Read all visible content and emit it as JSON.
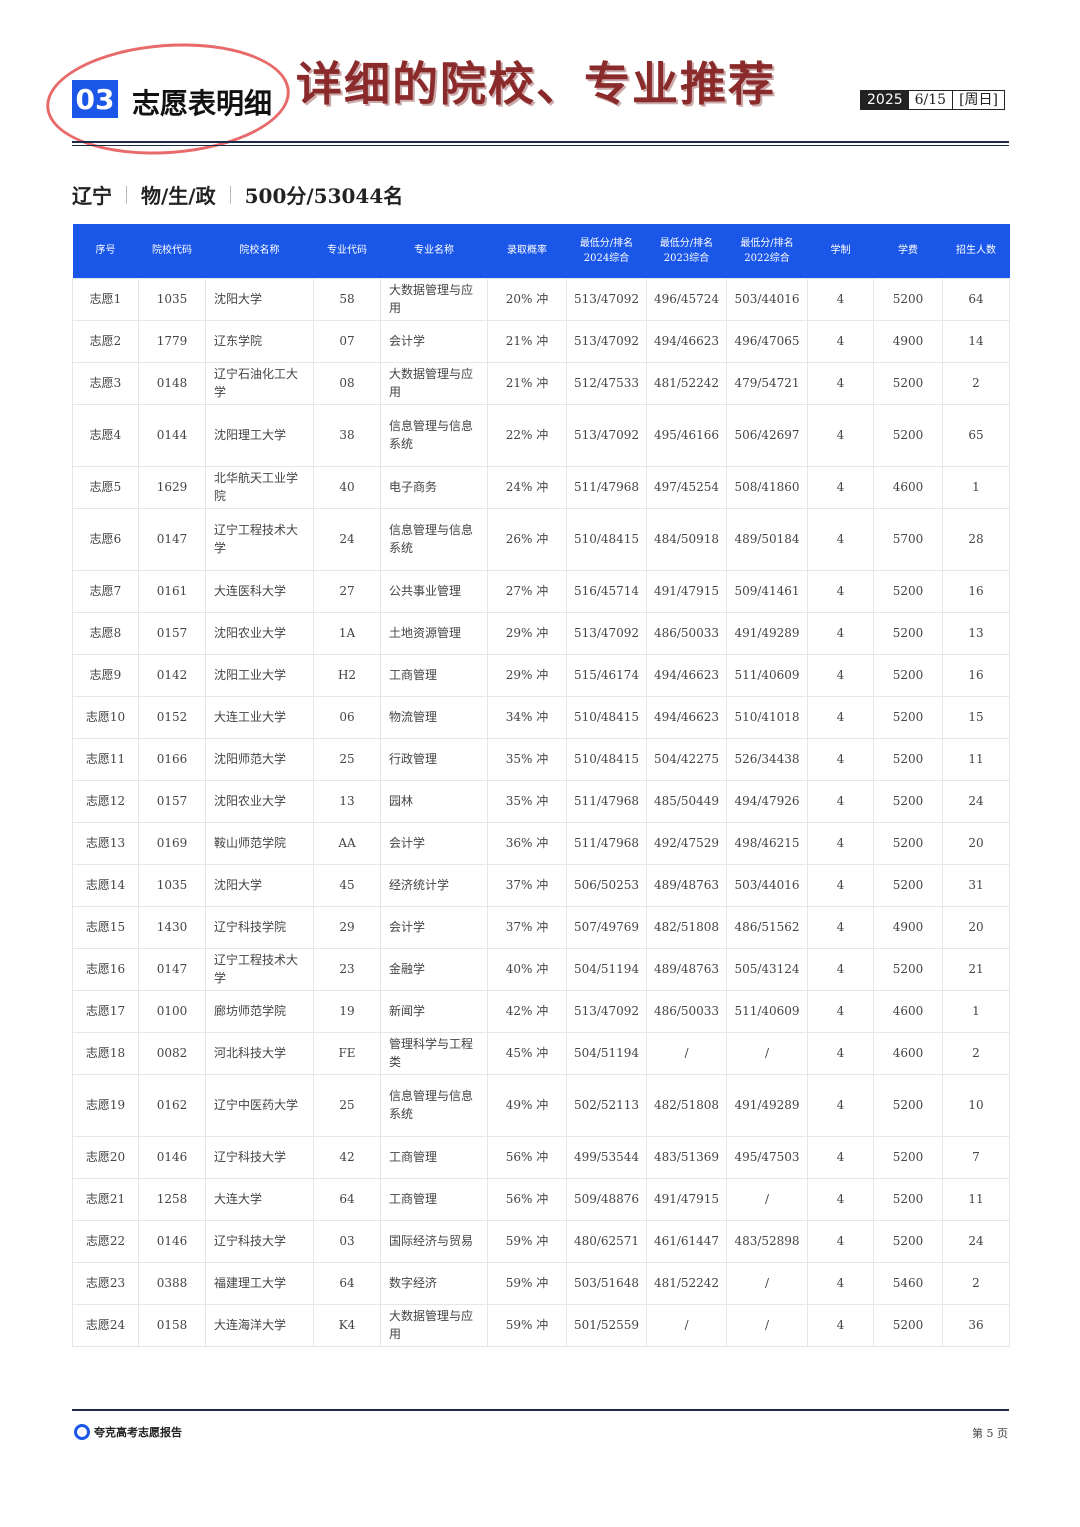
{
  "header": {
    "section_number": "03",
    "section_title": "志愿表明细",
    "annotation": "详细的院校、专业推荐",
    "date_year": "2025",
    "date_md": "6/15",
    "date_weekday": "[周日]"
  },
  "subheader": {
    "province": "辽宁",
    "subjects": "物/生/政",
    "score_rank": "500分/53044名"
  },
  "table": {
    "columns": [
      "序号",
      "院校代码",
      "院校名称",
      "专业代码",
      "专业名称",
      "录取概率",
      "最低分/排名\n2024综合",
      "最低分/排名\n2023综合",
      "最低分/排名\n2022综合",
      "学制",
      "学费",
      "招生人数"
    ],
    "rows": [
      [
        "志愿1",
        "1035",
        "沈阳大学",
        "58",
        "大数据管理与应用",
        "20% 冲",
        "513/47092",
        "496/45724",
        "503/44016",
        "4",
        "5200",
        "64"
      ],
      [
        "志愿2",
        "1779",
        "辽东学院",
        "07",
        "会计学",
        "21% 冲",
        "513/47092",
        "494/46623",
        "496/47065",
        "4",
        "4900",
        "14"
      ],
      [
        "志愿3",
        "0148",
        "辽宁石油化工大学",
        "08",
        "大数据管理与应用",
        "21% 冲",
        "512/47533",
        "481/52242",
        "479/54721",
        "4",
        "5200",
        "2"
      ],
      [
        "志愿4",
        "0144",
        "沈阳理工大学",
        "38",
        "信息管理与信息系统",
        "22% 冲",
        "513/47092",
        "495/46166",
        "506/42697",
        "4",
        "5200",
        "65"
      ],
      [
        "志愿5",
        "1629",
        "北华航天工业学院",
        "40",
        "电子商务",
        "24% 冲",
        "511/47968",
        "497/45254",
        "508/41860",
        "4",
        "4600",
        "1"
      ],
      [
        "志愿6",
        "0147",
        "辽宁工程技术大学",
        "24",
        "信息管理与信息系统",
        "26% 冲",
        "510/48415",
        "484/50918",
        "489/50184",
        "4",
        "5700",
        "28"
      ],
      [
        "志愿7",
        "0161",
        "大连医科大学",
        "27",
        "公共事业管理",
        "27% 冲",
        "516/45714",
        "491/47915",
        "509/41461",
        "4",
        "5200",
        "16"
      ],
      [
        "志愿8",
        "0157",
        "沈阳农业大学",
        "1A",
        "土地资源管理",
        "29% 冲",
        "513/47092",
        "486/50033",
        "491/49289",
        "4",
        "5200",
        "13"
      ],
      [
        "志愿9",
        "0142",
        "沈阳工业大学",
        "H2",
        "工商管理",
        "29% 冲",
        "515/46174",
        "494/46623",
        "511/40609",
        "4",
        "5200",
        "16"
      ],
      [
        "志愿10",
        "0152",
        "大连工业大学",
        "06",
        "物流管理",
        "34% 冲",
        "510/48415",
        "494/46623",
        "510/41018",
        "4",
        "5200",
        "15"
      ],
      [
        "志愿11",
        "0166",
        "沈阳师范大学",
        "25",
        "行政管理",
        "35% 冲",
        "510/48415",
        "504/42275",
        "526/34438",
        "4",
        "5200",
        "11"
      ],
      [
        "志愿12",
        "0157",
        "沈阳农业大学",
        "13",
        "园林",
        "35% 冲",
        "511/47968",
        "485/50449",
        "494/47926",
        "4",
        "5200",
        "24"
      ],
      [
        "志愿13",
        "0169",
        "鞍山师范学院",
        "AA",
        "会计学",
        "36% 冲",
        "511/47968",
        "492/47529",
        "498/46215",
        "4",
        "5200",
        "20"
      ],
      [
        "志愿14",
        "1035",
        "沈阳大学",
        "45",
        "经济统计学",
        "37% 冲",
        "506/50253",
        "489/48763",
        "503/44016",
        "4",
        "5200",
        "31"
      ],
      [
        "志愿15",
        "1430",
        "辽宁科技学院",
        "29",
        "会计学",
        "37% 冲",
        "507/49769",
        "482/51808",
        "486/51562",
        "4",
        "4900",
        "20"
      ],
      [
        "志愿16",
        "0147",
        "辽宁工程技术大学",
        "23",
        "金融学",
        "40% 冲",
        "504/51194",
        "489/48763",
        "505/43124",
        "4",
        "5200",
        "21"
      ],
      [
        "志愿17",
        "0100",
        "廊坊师范学院",
        "19",
        "新闻学",
        "42% 冲",
        "513/47092",
        "486/50033",
        "511/40609",
        "4",
        "4600",
        "1"
      ],
      [
        "志愿18",
        "0082",
        "河北科技大学",
        "FE",
        "管理科学与工程类",
        "45% 冲",
        "504/51194",
        "/",
        "/",
        "4",
        "4600",
        "2"
      ],
      [
        "志愿19",
        "0162",
        "辽宁中医药大学",
        "25",
        "信息管理与信息系统",
        "49% 冲",
        "502/52113",
        "482/51808",
        "491/49289",
        "4",
        "5200",
        "10"
      ],
      [
        "志愿20",
        "0146",
        "辽宁科技大学",
        "42",
        "工商管理",
        "56% 冲",
        "499/53544",
        "483/51369",
        "495/47503",
        "4",
        "5200",
        "7"
      ],
      [
        "志愿21",
        "1258",
        "大连大学",
        "64",
        "工商管理",
        "56% 冲",
        "509/48876",
        "491/47915",
        "/",
        "4",
        "5200",
        "11"
      ],
      [
        "志愿22",
        "0146",
        "辽宁科技大学",
        "03",
        "国际经济与贸易",
        "59% 冲",
        "480/62571",
        "461/61447",
        "483/52898",
        "4",
        "5200",
        "24"
      ],
      [
        "志愿23",
        "0388",
        "福建理工大学",
        "64",
        "数字经济",
        "59% 冲",
        "503/51648",
        "481/52242",
        "/",
        "4",
        "5460",
        "2"
      ],
      [
        "志愿24",
        "0158",
        "大连海洋大学",
        "K4",
        "大数据管理与应用",
        "59% 冲",
        "501/52559",
        "/",
        "/",
        "4",
        "5200",
        "36"
      ]
    ]
  },
  "footer": {
    "brand": "夸克高考志愿报告",
    "page_label": "第 5 页"
  },
  "colors": {
    "accent": "#1a56e8",
    "rule": "#1d2b4a",
    "annotation": "#8a2a2a",
    "circle": "#e86a6a"
  }
}
